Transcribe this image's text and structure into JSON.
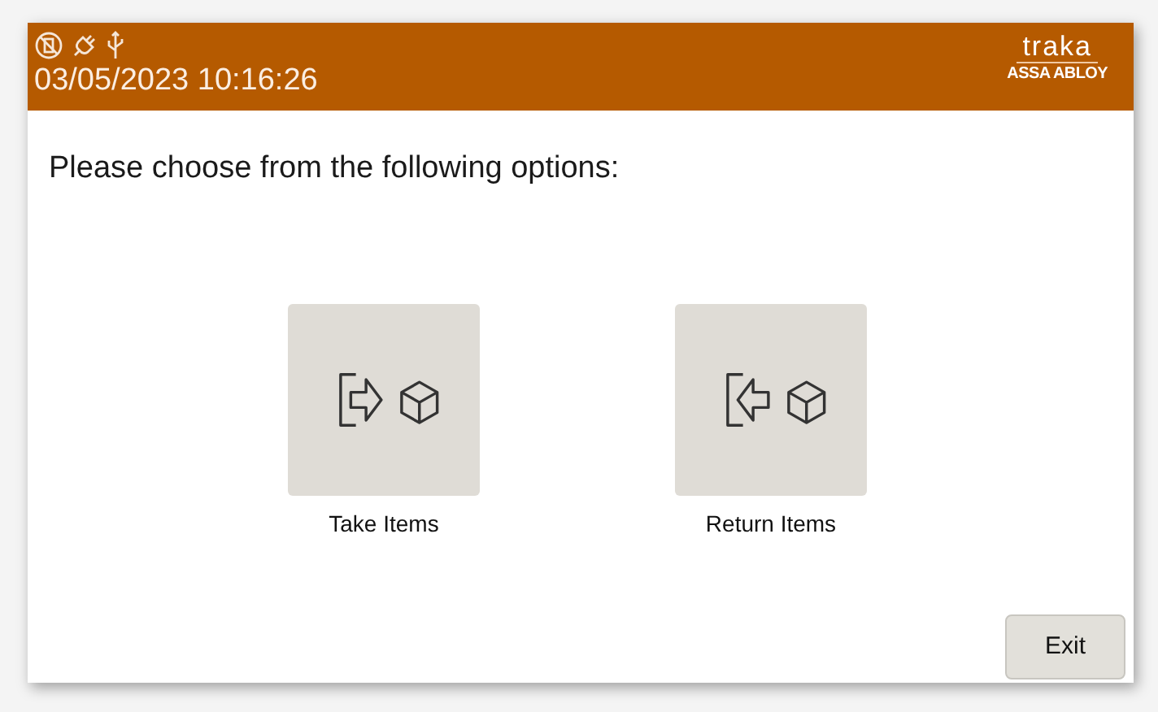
{
  "header": {
    "datetime": "03/05/2023 10:16:26",
    "logo": {
      "name": "traka",
      "tagline": "ASSA ABLOY"
    }
  },
  "prompt": "Please choose from the following options:",
  "options": [
    {
      "kind": "take",
      "label": "Take Items"
    },
    {
      "kind": "return",
      "label": "Return Items"
    }
  ],
  "exit_button": "Exit"
}
